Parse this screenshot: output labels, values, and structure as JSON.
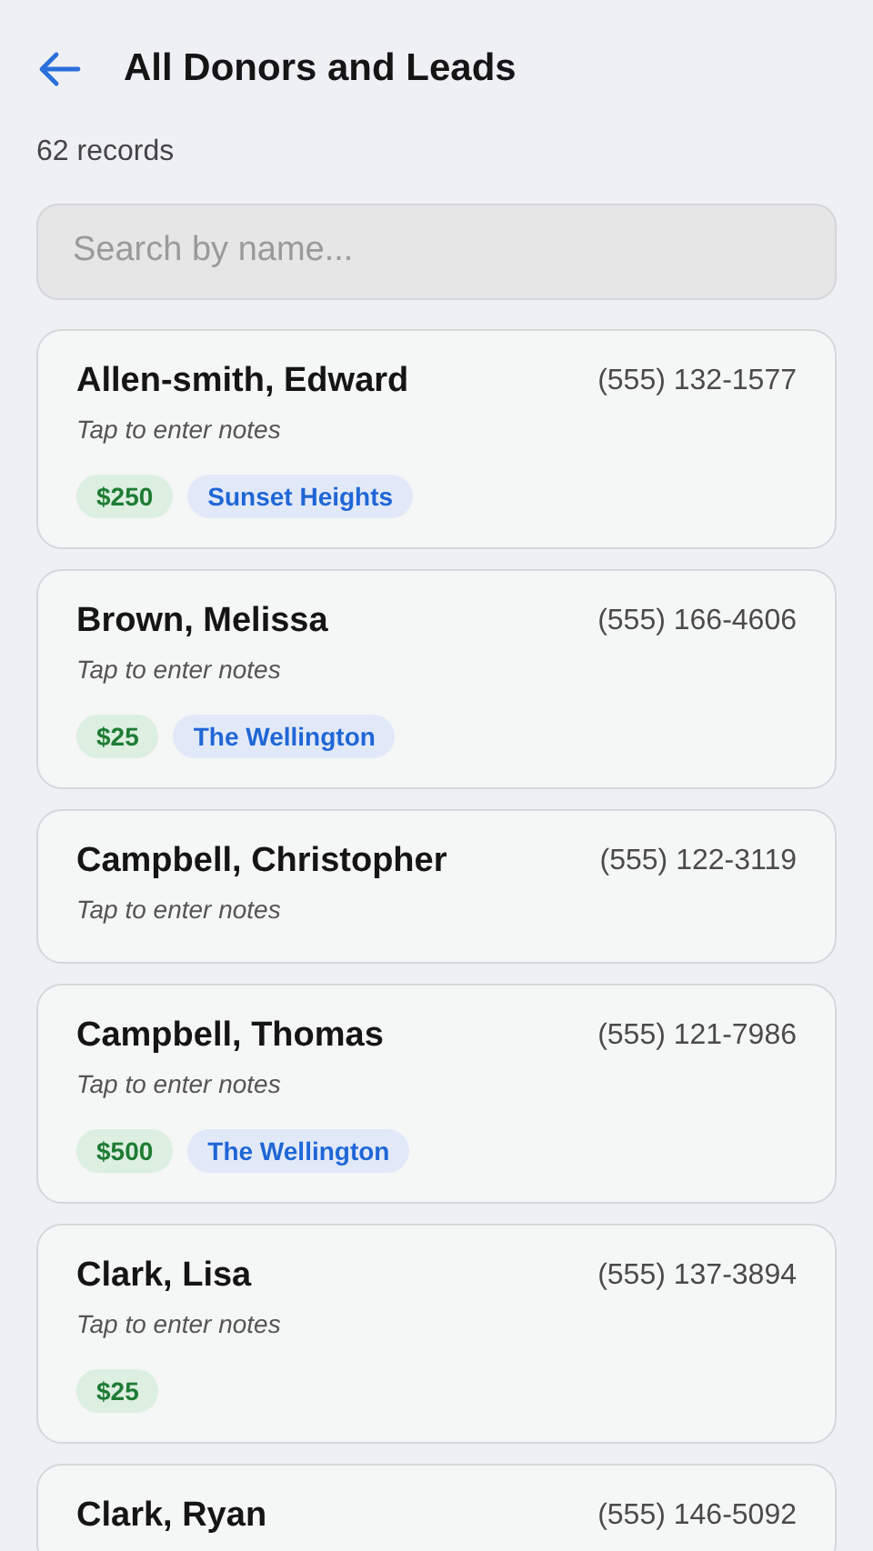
{
  "header": {
    "title": "All Donors and Leads"
  },
  "record_count": "62 records",
  "search": {
    "placeholder": "Search by name..."
  },
  "donors": [
    {
      "name": "Allen-smith, Edward",
      "phone": "(555) 132-1577",
      "notes": "Tap to enter notes",
      "tags": [
        {
          "kind": "amount",
          "text": "$250"
        },
        {
          "kind": "location",
          "text": "Sunset Heights"
        }
      ]
    },
    {
      "name": "Brown, Melissa",
      "phone": "(555) 166-4606",
      "notes": "Tap to enter notes",
      "tags": [
        {
          "kind": "amount",
          "text": "$25"
        },
        {
          "kind": "location",
          "text": "The Wellington"
        }
      ]
    },
    {
      "name": "Campbell, Christopher",
      "phone": "(555) 122-3119",
      "notes": "Tap to enter notes"
    },
    {
      "name": "Campbell, Thomas",
      "phone": "(555) 121-7986",
      "notes": "Tap to enter notes",
      "tags": [
        {
          "kind": "amount",
          "text": "$500"
        },
        {
          "kind": "location",
          "text": "The Wellington"
        }
      ]
    },
    {
      "name": "Clark, Lisa",
      "phone": "(555) 137-3894",
      "notes": "Tap to enter notes",
      "tags": [
        {
          "kind": "amount",
          "text": "$25"
        }
      ]
    },
    {
      "name": "Clark, Ryan",
      "phone": "(555) 146-5092"
    }
  ]
}
